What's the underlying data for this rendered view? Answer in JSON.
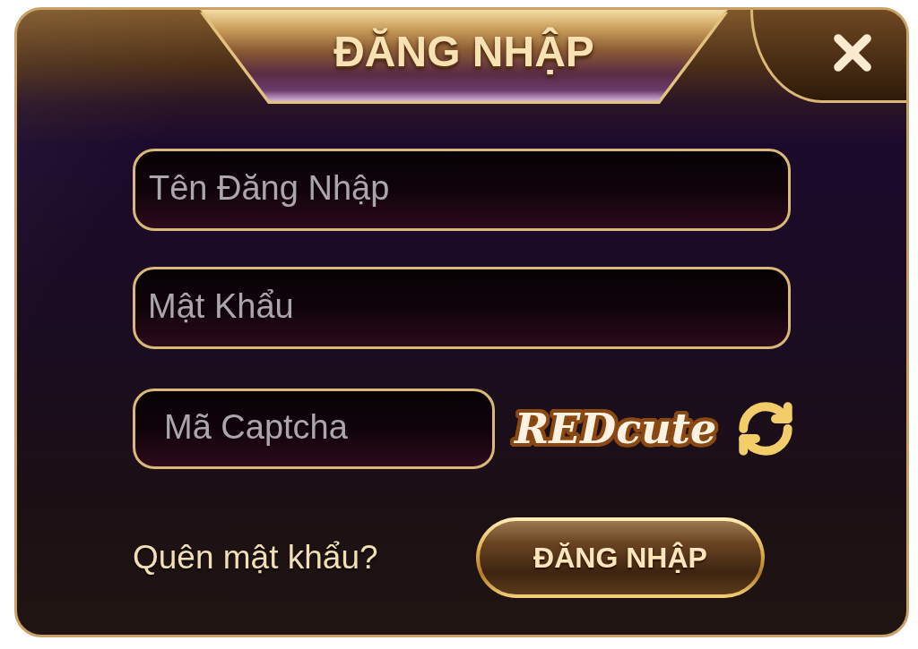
{
  "dialog": {
    "title": "ĐĂNG NHẬP"
  },
  "username": {
    "placeholder": "Tên Đăng Nhập"
  },
  "password": {
    "placeholder": "Mật Khẩu"
  },
  "captcha": {
    "placeholder": "Mã Captcha",
    "code": "REDcute"
  },
  "forgot_password_link": "Quên mật khẩu?",
  "submit_button": "ĐĂNG NHẬP"
}
